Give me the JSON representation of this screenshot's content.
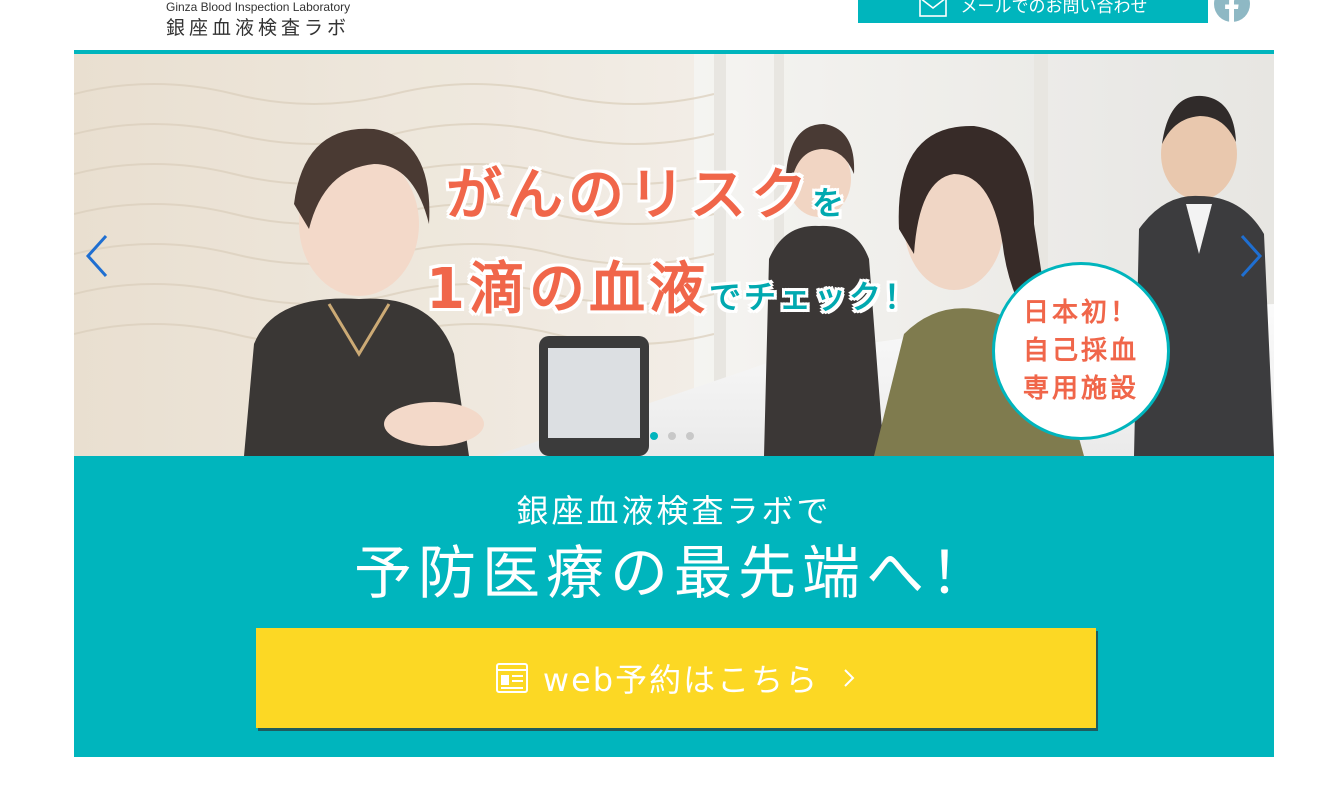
{
  "header": {
    "logo_en": "Ginza Blood Inspection Laboratory",
    "logo_ja": "銀座血液検査ラボ",
    "mail_button_label": "メールでのお問い合わせ"
  },
  "hero": {
    "headline_line1_main": "がんのリスク",
    "headline_line1_small": "を",
    "headline_line2_main": "1滴の血液",
    "headline_line2_small": "でチェック！",
    "badge_line1": "日本初！",
    "badge_line2": "自己採血",
    "badge_line3": "専用施設",
    "slide_count": 3,
    "active_slide": 1
  },
  "band": {
    "subtitle": "銀座血液検査ラボで",
    "title": "予防医療の最先端へ！",
    "web_button_label": "web予約はこちら"
  },
  "colors": {
    "teal": "#00b5bd",
    "coral": "#f0664a",
    "yellow": "#fcd824"
  }
}
